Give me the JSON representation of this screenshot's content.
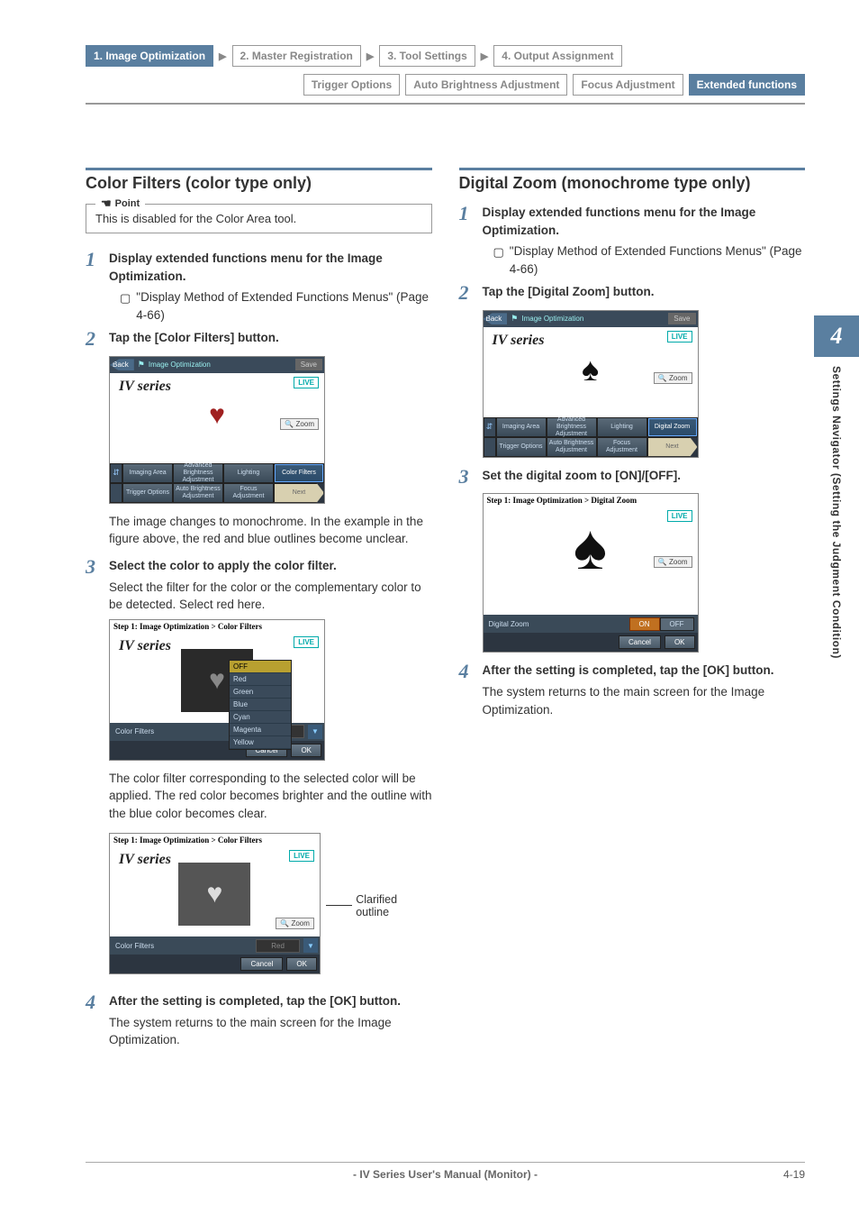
{
  "nav": {
    "c1": "1. Image Optimization",
    "c2": "2. Master Registration",
    "c3": "3. Tool Settings",
    "c4": "4. Output Assignment"
  },
  "tabs": {
    "t1": "Trigger Options",
    "t2": "Auto Brightness Adjustment",
    "t3": "Focus Adjustment",
    "t4": "Extended functions"
  },
  "left": {
    "title": "Color Filters (color type only)",
    "point_label": "Point",
    "point_text": "This is disabled for the Color Area tool.",
    "s1_lead": "Display extended functions menu for the Image Optimization.",
    "s1_ref": "\"Display Method of Extended Functions Menus\" (Page 4-66)",
    "s2_lead": "Tap the [Color Filters] button.",
    "s2_desc": "The image changes to monochrome. In the example in the figure above, the red and blue outlines become unclear.",
    "s3_lead": "Select the color to apply the color filter.",
    "s3_desc": "Select the filter for the color or the complementary color to be detected. Select red here.",
    "s3_result": "The color filter corresponding to the selected color will be applied. The red color becomes brighter and the outline with the blue color becomes clear.",
    "s3_callout": "Clarified outline",
    "s4_lead": "After the setting is completed, tap the [OK] button.",
    "s4_desc": "The system returns to the main screen for the Image Optimization."
  },
  "right": {
    "title": "Digital Zoom (monochrome type only)",
    "s1_lead": "Display extended functions menu for the Image Optimization.",
    "s1_ref": "\"Display Method of Extended Functions Menus\" (Page 4-66)",
    "s2_lead": "Tap the [Digital Zoom] button.",
    "s3_lead": "Set the digital zoom to [ON]/[OFF].",
    "s4_lead": "After the setting is completed, tap the [OK] button.",
    "s4_desc": "The system returns to the main screen for the Image Optimization."
  },
  "shot": {
    "back": "Back",
    "title": "Image Optimization",
    "save": "Save",
    "iv": "IV series",
    "live": "LIVE",
    "zoom": "🔍 Zoom",
    "imaging": "Imaging Area",
    "adv": "Advanced Brightness Adjustment",
    "lighting": "Lighting",
    "colorfilters": "Color Filters",
    "digitalzoom": "Digital Zoom",
    "trigger": "Trigger Options",
    "auto": "Auto Brightness Adjustment",
    "focus": "Focus Adjustment",
    "next": "Next",
    "crumb_cf": "Step 1: Image Optimization > Color Filters",
    "crumb_dz": "Step 1: Image Optimization > Digital Zoom",
    "dd_off": "OFF",
    "dd_red": "Red",
    "dd_green": "Green",
    "dd_blue": "Blue",
    "dd_cyan": "Cyan",
    "dd_magenta": "Magenta",
    "dd_yellow": "Yellow",
    "cf_label": "Color Filters",
    "dz_label": "Digital Zoom",
    "sel_off": "OFF",
    "sel_red": "Red",
    "on": "ON",
    "off": "OFF",
    "cancel": "Cancel",
    "ok": "OK"
  },
  "side": {
    "num": "4",
    "text": "Settings Navigator (Setting the Judgment Condition)"
  },
  "footer": {
    "center": "- IV Series User's Manual (Monitor) -",
    "page": "4-19"
  }
}
